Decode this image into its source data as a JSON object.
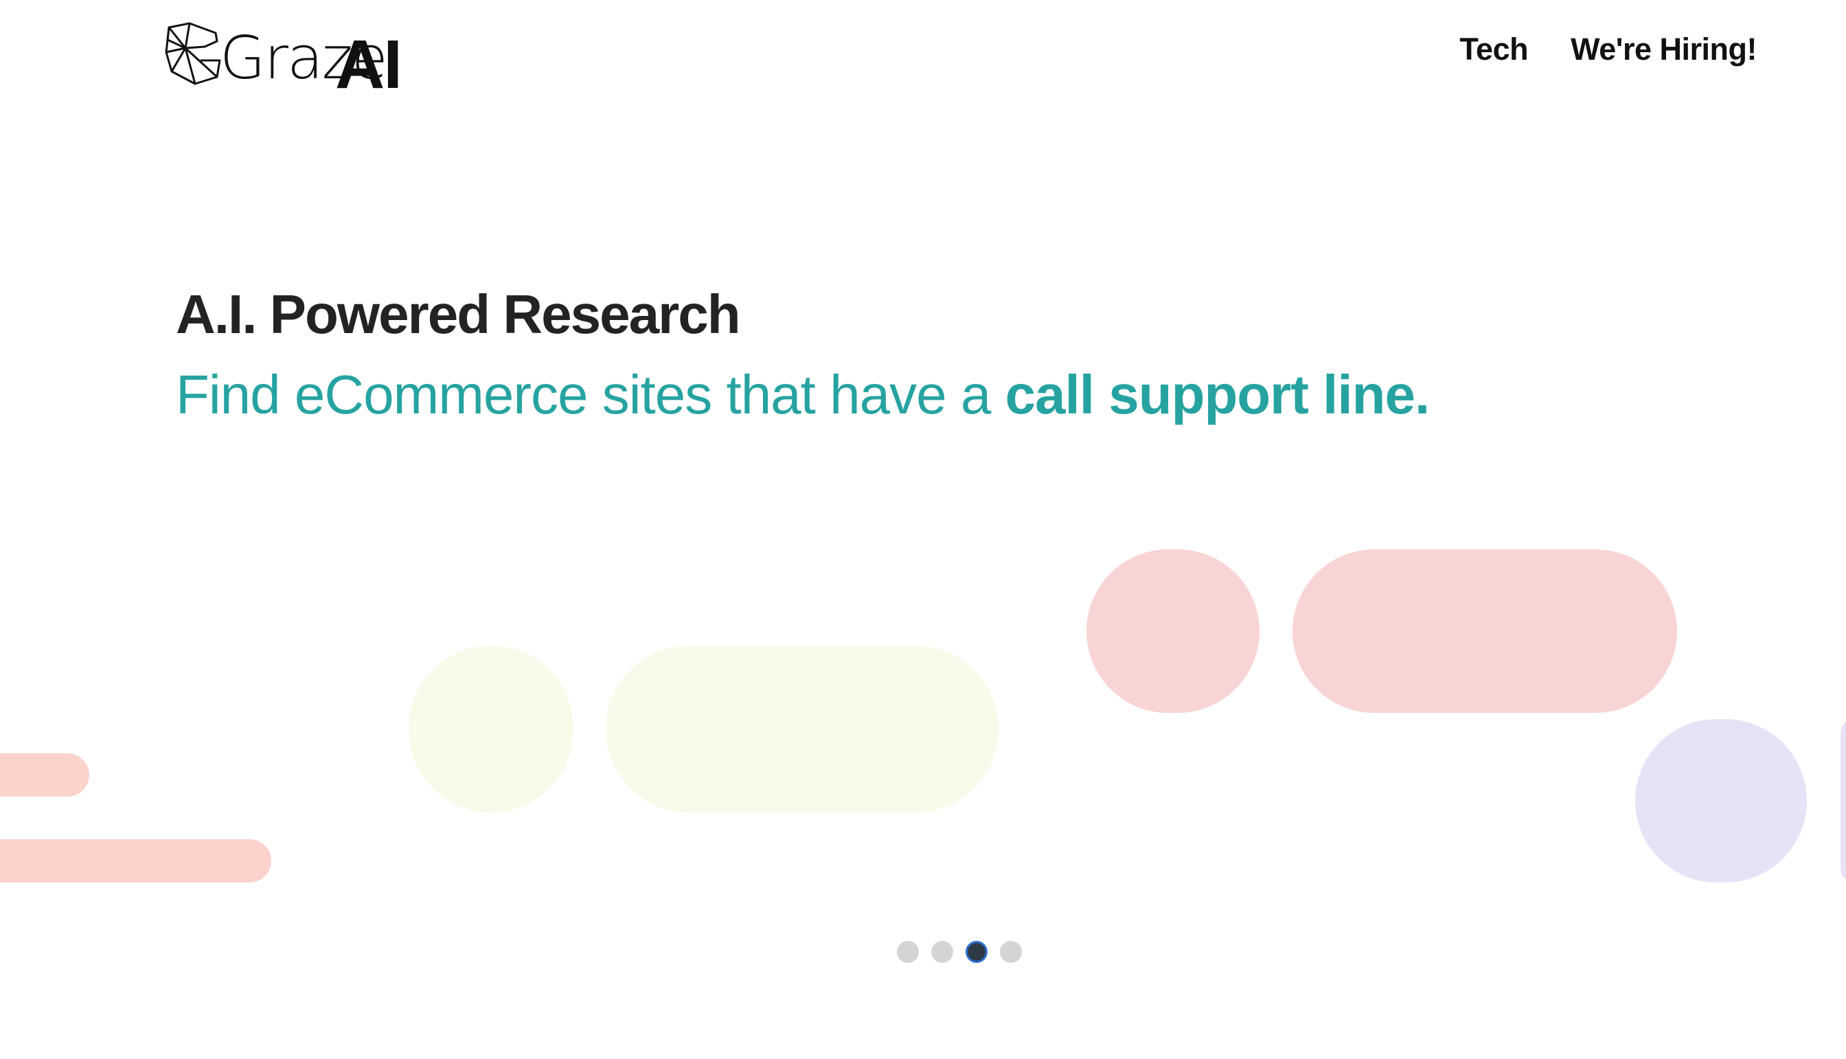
{
  "header": {
    "logo": {
      "text_light": "Graze",
      "text_bold": "AI"
    },
    "nav": [
      {
        "label": "Tech"
      },
      {
        "label": "We're Hiring!"
      }
    ]
  },
  "hero": {
    "title": "A.I. Powered Research",
    "subtitle_prefix": "Find eCommerce sites that have a ",
    "subtitle_highlight": "call support line."
  },
  "carousel": {
    "slide_count": 4,
    "active_index": 2
  },
  "colors": {
    "title": "#232323",
    "accent_teal": "#26a3a1",
    "shape_pink": "#f9d4d4",
    "shape_salmon": "#fbd2cc",
    "shape_cream": "#f9faea",
    "shape_lavender": "#e6e3f6",
    "dot_inactive": "#d4d4d4",
    "dot_active": "#2e3a46"
  }
}
